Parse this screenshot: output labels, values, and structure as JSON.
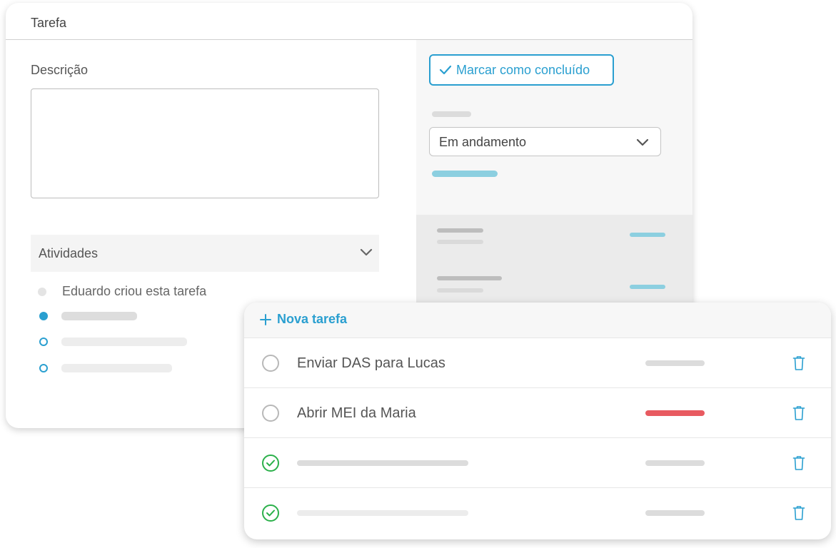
{
  "task_panel": {
    "title": "Tarefa",
    "description_label": "Descrição",
    "description_value": "",
    "activities_label": "Atividades",
    "activities": [
      {
        "text": "Eduardo criou esta tarefa",
        "marker": "grey-dot"
      },
      {
        "text": "",
        "marker": "filled-dot"
      },
      {
        "text": "",
        "marker": "hollow-dot"
      },
      {
        "text": "",
        "marker": "hollow-dot"
      }
    ],
    "mark_done_label": "Marcar como concluído",
    "status_value": "Em andamento"
  },
  "task_list": {
    "new_task_label": "Nova tarefa",
    "tasks": [
      {
        "name": "Enviar DAS para Lucas",
        "done": false,
        "tag_color": "#dcdcdc"
      },
      {
        "name": "Abrir MEI da Maria",
        "done": false,
        "tag_color": "#e85a60"
      },
      {
        "name": "",
        "done": true,
        "tag_color": "#dcdcdc"
      },
      {
        "name": "",
        "done": true,
        "tag_color": "#dcdcdc"
      }
    ]
  },
  "colors": {
    "accent": "#2a9fd0",
    "success": "#2bb04a",
    "urgent": "#e85a60"
  },
  "icons": [
    "check-icon",
    "chevron-down-icon",
    "plus-icon",
    "circle-icon",
    "check-circle-icon",
    "trash-icon"
  ]
}
